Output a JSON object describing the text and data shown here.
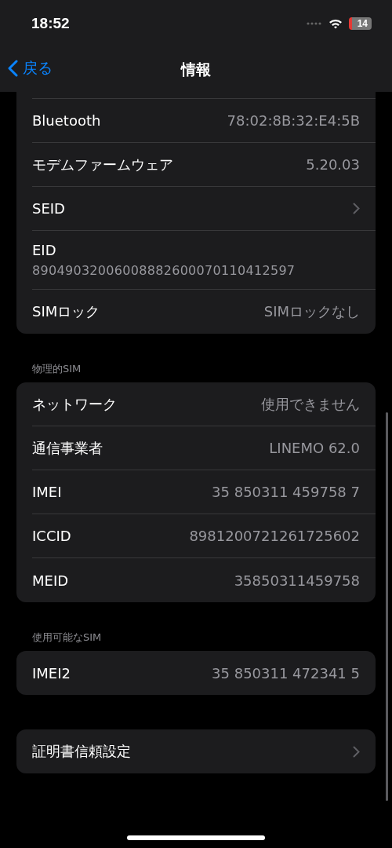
{
  "status_bar": {
    "time": "18:52",
    "battery": "14"
  },
  "nav": {
    "back": "戻る",
    "title": "情報"
  },
  "sections": [
    {
      "rows": [
        {
          "kind": "value",
          "label": "Bluetooth",
          "value": "78:02:8B:32:E4:5B"
        },
        {
          "kind": "value",
          "label": "モデムファームウェア",
          "value": "5.20.03"
        },
        {
          "kind": "chevron",
          "label": "SEID"
        },
        {
          "kind": "stacked",
          "label": "EID",
          "value": "89049032006008882600070110412597"
        },
        {
          "kind": "value",
          "label": "SIMロック",
          "value": "SIMロックなし"
        }
      ]
    },
    {
      "header": "物理的SIM",
      "rows": [
        {
          "kind": "value",
          "label": "ネットワーク",
          "value": "使用できません"
        },
        {
          "kind": "value",
          "label": "通信事業者",
          "value": "LINEMO 62.0"
        },
        {
          "kind": "value",
          "label": "IMEI",
          "value": "35 850311 459758 7"
        },
        {
          "kind": "value",
          "label": "ICCID",
          "value": "8981200721261725602"
        },
        {
          "kind": "value",
          "label": "MEID",
          "value": "35850311459758"
        }
      ]
    },
    {
      "header": "使用可能なSIM",
      "rows": [
        {
          "kind": "value",
          "label": "IMEI2",
          "value": "35 850311 472341 5"
        }
      ]
    },
    {
      "rows": [
        {
          "kind": "chevron",
          "label": "証明書信頼設定"
        }
      ]
    }
  ]
}
